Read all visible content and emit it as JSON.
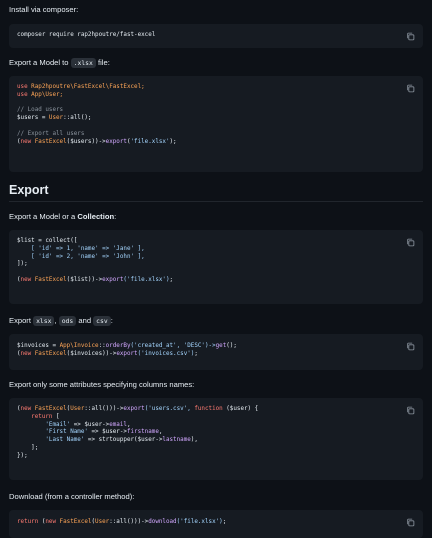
{
  "sections": {
    "install_text": "Install via composer:",
    "export_model_pre": "Export a Model to ",
    "export_model_code": ".xlsx",
    "export_model_post": " file:",
    "heading_export": "Export",
    "export_model_or": "Export a Model or a ",
    "collection_word": "Collection",
    "colon": ":",
    "export_formats_pre": "Export ",
    "fmt_xlsx": "xlsx",
    "comma": ",",
    "fmt_ods": "ods",
    "and_word": "and",
    "fmt_csv": "csv",
    "export_formats_post": ":",
    "export_some": "Export only some attributes specifying columns names:",
    "download": "Download (from a controller method):"
  },
  "code": {
    "composer": "composer require rap2hpoutre/fast-excel",
    "block2": {
      "l1_kw": "use",
      "l1_rest": " Rap2hpoutre\\FastExcel\\FastExcel;",
      "l2_kw": "use",
      "l2_rest": " App\\User;",
      "l3_comment": "// Load users",
      "l4_var": "$users",
      "l4_eq": " = ",
      "l4_cls": "User",
      "l4_rest": "::all();",
      "l5_comment": "// Export all users",
      "l6_paren": "(",
      "l6_new": "new",
      "l6_cls": " FastExcel",
      "l6_mid": "($users))->",
      "l6_fn": "export",
      "l6_open": "(",
      "l6_str": "'file.xlsx'",
      "l6_end": ");"
    },
    "block3": {
      "l1_var": "$list",
      "l1_rest": " = collect([",
      "l2": "    [ 'id' => 1, 'name' => 'Jane' ],",
      "l3": "    [ 'id' => 2, 'name' => 'John' ],",
      "l4": "]);",
      "l5_pre": "(",
      "l5_new": "new",
      "l5_cls": " FastExcel",
      "l5_mid": "($list))->",
      "l5_fn": "export",
      "l5_str": "('file.xlsx')",
      "l5_end": ";"
    },
    "block4": {
      "l1_var": "$invoices",
      "l1_eq": " = ",
      "l1_cls": "App\\Invoice",
      "l1_m1": "::",
      "l1_fn1": "orderBy",
      "l1_args": "('created_at', 'DESC')->",
      "l1_fn2": "get",
      "l1_end": "();",
      "l2_pre": "(",
      "l2_new": "new",
      "l2_cls": " FastExcel",
      "l2_mid": "($invoices))->",
      "l2_fn": "export",
      "l2_str": "('invoices.csv')",
      "l2_end": ";"
    },
    "block5": {
      "l1_pre": "(",
      "l1_new": "new",
      "l1_cls": " FastExcel",
      "l1_mid": "(",
      "l1_cls2": "User",
      "l1_mid2": "::all()))->",
      "l1_fn": "export",
      "l1_str": "('users.csv', ",
      "l1_function": "function",
      "l1_arg": " ($user) {",
      "l2_kw": "    return",
      "l2_rest": " [",
      "l3_key": "        'Email'",
      "l3_rest": " => $user->",
      "l3_prop": "email",
      "l3_end": ",",
      "l4_key": "        'First Name'",
      "l4_rest": " => $user->",
      "l4_prop": "firstname",
      "l4_end": ",",
      "l5_key": "        'Last Name'",
      "l5_rest": " => strtoupper($user->",
      "l5_prop": "lastname",
      "l5_end": "),",
      "l6": "    ];",
      "l7": "});"
    },
    "block6": {
      "kw": "return",
      "pre": " (",
      "new": "new",
      "cls": " FastExcel",
      "mid": "(",
      "cls2": "User",
      "mid2": "::all()))->",
      "fn": "download",
      "str": "('file.xlsx')",
      "end": ";"
    }
  },
  "icons": {
    "copy": "copy-icon"
  },
  "colors": {
    "background": "#0d1117",
    "code_bg": "#161b22",
    "keyword": "#ff7b72",
    "function": "#d2a8ff",
    "string": "#a5d6ff",
    "comment": "#8b949e"
  }
}
